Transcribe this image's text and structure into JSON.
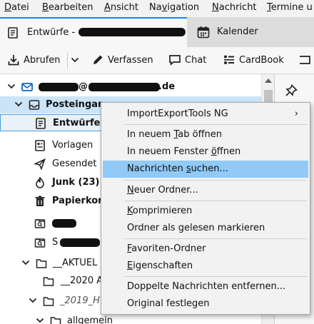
{
  "menubar": {
    "items": [
      {
        "pre": "",
        "u": "D",
        "post": "atei"
      },
      {
        "pre": "",
        "u": "B",
        "post": "earbeiten"
      },
      {
        "pre": "",
        "u": "A",
        "post": "nsicht"
      },
      {
        "pre": "Na",
        "u": "v",
        "post": "igation"
      },
      {
        "pre": "",
        "u": "N",
        "post": "achricht"
      },
      {
        "pre": "",
        "u": "T",
        "post": "ermine u"
      }
    ]
  },
  "tabs": {
    "active": {
      "label": "Entwürfe - "
    },
    "inactive": {
      "label": "Kalender"
    }
  },
  "toolbar": {
    "fetch": "Abrufen",
    "compose": "Verfassen",
    "chat": "Chat",
    "cardbook": "CardBook"
  },
  "folders": {
    "account_suffix": "@",
    "account_domain": ".de",
    "inbox": "Posteingan",
    "drafts": "Entwürfe",
    "templates": "Vorlagen",
    "sent": "Gesendet",
    "junk": "Junk (23)",
    "trash": "Papierkor",
    "saved_search_2": "S",
    "aktuell": "__AKTUEL",
    "y2020": "__2020 A",
    "y2019": "_2019_H",
    "allgemein": "allgemein"
  },
  "context_menu": {
    "items": [
      {
        "pre": "ImportExportTools NG",
        "u": "",
        "post": ""
      },
      {
        "pre": "In neuem ",
        "u": "T",
        "post": "ab öffnen"
      },
      {
        "pre": "In neuem Fenster ",
        "u": "ö",
        "post": "ffnen"
      },
      {
        "pre": "Nachrichten ",
        "u": "s",
        "post": "uchen..."
      },
      {
        "pre": "",
        "u": "N",
        "post": "euer Ordner..."
      },
      {
        "pre": "",
        "u": "K",
        "post": "omprimieren"
      },
      {
        "pre": "Ordner als gelesen markieren",
        "u": "",
        "post": ""
      },
      {
        "pre": "",
        "u": "F",
        "post": "avoriten-Ordner"
      },
      {
        "pre": "",
        "u": "E",
        "post": "igenschaften"
      },
      {
        "pre": "Doppelte Nachrichten entfernen...",
        "u": "",
        "post": ""
      },
      {
        "pre": "Original festlegen",
        "u": "",
        "post": ""
      }
    ]
  },
  "colors": {
    "accent": "#0a84ff",
    "menu_highlight": "#91c9f7",
    "selection": "#cce4f7"
  },
  "icons": [
    "mail-account-icon",
    "inbox-icon",
    "drafts-icon",
    "templates-icon",
    "sent-icon",
    "junk-icon",
    "trash-icon",
    "saved-search-icon",
    "folder-icon",
    "calendar-icon",
    "pencil-icon",
    "chat-icon",
    "cardbook-icon",
    "pin-icon"
  ]
}
